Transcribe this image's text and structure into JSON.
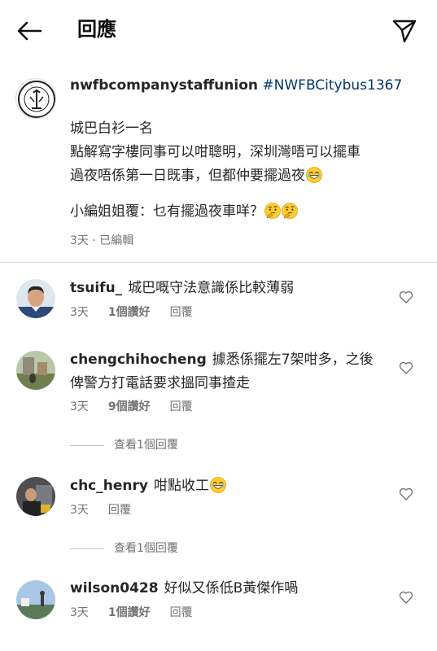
{
  "header": {
    "title": "回應",
    "back_icon": "arrow-left-icon",
    "send_icon": "paper-plane-icon"
  },
  "caption": {
    "username": "nwfbcompanystaffunion",
    "hashtag": "#NWFBCitybus1367",
    "line1": "城巴白衫一名",
    "line2": "點解寫字樓同事可以咁聰明，深圳灣唔可以擺車",
    "line3": "過夜唔係第一日既事，但都仲要擺過夜",
    "line4": "小編姐姐覆：乜有擺過夜車咩？",
    "time": "3天",
    "edited": "已編輯"
  },
  "comments": [
    {
      "username": "tsuifu_",
      "text": "城巴嘅守法意識係比較薄弱",
      "time": "3天",
      "likes": "1個讚好",
      "reply": "回覆"
    },
    {
      "username": "chengchihocheng",
      "text_line1": "據悉係擺左7架咁多，之後",
      "text_line2": "俾警方打電話要求搵同事揸走",
      "time": "3天",
      "likes": "9個讚好",
      "reply": "回覆",
      "view_replies": "查看1個回覆"
    },
    {
      "username": "chc_henry",
      "text": "咁點收工",
      "time": "3天",
      "reply": "回覆",
      "view_replies": "查看1個回覆"
    },
    {
      "username": "wilson0428",
      "text": "好似又係低B黃傑作喎",
      "time": "3天",
      "likes": "1個讚好",
      "reply": "回覆"
    }
  ],
  "colors": {
    "hashtag": "#00376b",
    "meta": "#737373",
    "divider": "#dbdbdb"
  }
}
